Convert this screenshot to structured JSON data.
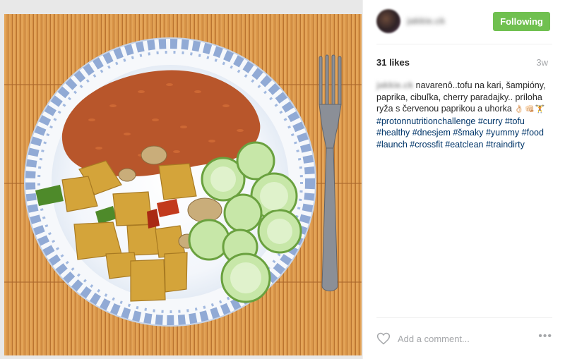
{
  "post": {
    "photo_alt": "photo",
    "header": {
      "username": "jakkie.ck",
      "follow_label": "Following"
    },
    "likes": "31 likes",
    "age": "3w",
    "caption": {
      "author": "jakkie.ck",
      "text": " navarenô..tofu na kari, šampióny, paprika, cibuľka, cherry paradajky.. príloha ryža s červenou paprikou a uhorka ",
      "emoji": "👌🏻👊🏻🏋",
      "hashtags": "#protonnutritionchallenge #curry #tofu #healthy #dnesjem #šmaky #yummy #food #launch #crossfit #eatclean #traindirty"
    },
    "comment": {
      "placeholder": "Add a comment...",
      "more_label": "•••"
    },
    "icons": {
      "like": "heart-outline-icon",
      "more": "ellipsis-icon"
    },
    "colors": {
      "follow_button": "#70c050",
      "hashtag": "#003569"
    }
  }
}
